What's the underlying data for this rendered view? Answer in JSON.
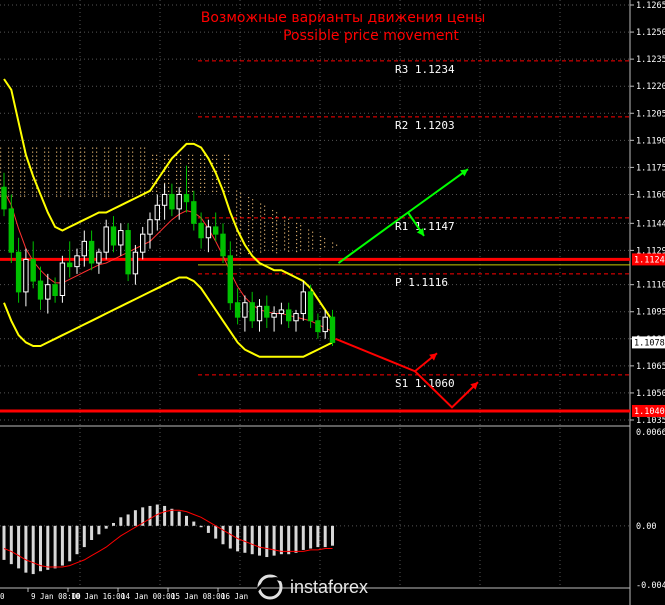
{
  "titles": {
    "ru": "Возможные варианты движения цены",
    "en": "Possible price movement"
  },
  "chart_data": {
    "type": "candlestick",
    "main_axis": {
      "ticks": [
        "1.1265",
        "1.1250",
        "1.1235",
        "1.1220",
        "1.1205",
        "1.1190",
        "1.1175",
        "1.1160",
        "1.1144",
        "1.1129",
        "1.1110",
        "1.1095",
        "1.1080",
        "1.1065",
        "1.1050",
        "1.1035"
      ],
      "ylim": [
        1.1035,
        1.1265
      ],
      "current_price": "1.1078",
      "marked_price_upper": "1.1124",
      "marked_price_lower": "1.1040"
    },
    "sub_axis": {
      "ticks": [
        "0.00661",
        "0.00",
        "-0.00417"
      ],
      "ylim": [
        -0.00417,
        0.00661
      ]
    },
    "levels": [
      {
        "label": "R3",
        "value": "1.1234",
        "price": 1.1234
      },
      {
        "label": "R2",
        "value": "1.1203",
        "price": 1.1203
      },
      {
        "label": "R1",
        "value": "1.1147",
        "price": 1.1147
      },
      {
        "label": "P",
        "value": "1.1116",
        "price": 1.1116
      },
      {
        "label": "S1",
        "value": "1.1060",
        "price": 1.106
      }
    ],
    "x_ticks": [
      "9 Jan 08:00",
      "10 Jan 16:00",
      "14 Jan 00:00",
      "15 Jan 08:00",
      "16 Jan"
    ],
    "x_tick_partial": "0",
    "colors": {
      "bull": "#ffffff",
      "bear": "#00c000",
      "level": "#ff0000",
      "bollinger": "#ffff00",
      "kumo": "#d4a96a",
      "arrow_up": "#00ff00",
      "arrow_down": "#ff0000",
      "macd_signal": "#ff0000",
      "grid": "#555555"
    },
    "candles": [
      [
        1.1164,
        1.1172,
        1.1148,
        1.1152
      ],
      [
        1.1152,
        1.116,
        1.1122,
        1.1128
      ],
      [
        1.1128,
        1.1136,
        1.11,
        1.1106
      ],
      [
        1.1106,
        1.113,
        1.1098,
        1.1124
      ],
      [
        1.1124,
        1.1134,
        1.1108,
        1.1112
      ],
      [
        1.1112,
        1.112,
        1.1096,
        1.1102
      ],
      [
        1.1102,
        1.1116,
        1.1094,
        1.111
      ],
      [
        1.111,
        1.1114,
        1.11,
        1.1104
      ],
      [
        1.1104,
        1.1126,
        1.11,
        1.1122
      ],
      [
        1.1122,
        1.1134,
        1.1114,
        1.112
      ],
      [
        1.112,
        1.113,
        1.1116,
        1.1126
      ],
      [
        1.1126,
        1.114,
        1.112,
        1.1134
      ],
      [
        1.1134,
        1.114,
        1.1118,
        1.1122
      ],
      [
        1.1122,
        1.113,
        1.1116,
        1.1128
      ],
      [
        1.1128,
        1.1146,
        1.1124,
        1.1142
      ],
      [
        1.1142,
        1.1148,
        1.1128,
        1.1132
      ],
      [
        1.1132,
        1.1144,
        1.1126,
        1.114
      ],
      [
        1.114,
        1.1144,
        1.1112,
        1.1116
      ],
      [
        1.1116,
        1.1132,
        1.111,
        1.1128
      ],
      [
        1.1128,
        1.1142,
        1.1124,
        1.1138
      ],
      [
        1.1138,
        1.115,
        1.113,
        1.1146
      ],
      [
        1.1146,
        1.116,
        1.114,
        1.1154
      ],
      [
        1.1154,
        1.1166,
        1.1146,
        1.116
      ],
      [
        1.116,
        1.1166,
        1.1148,
        1.1152
      ],
      [
        1.1152,
        1.1164,
        1.1146,
        1.116
      ],
      [
        1.116,
        1.1176,
        1.115,
        1.1156
      ],
      [
        1.1156,
        1.1162,
        1.114,
        1.1144
      ],
      [
        1.1144,
        1.115,
        1.113,
        1.1136
      ],
      [
        1.1136,
        1.1146,
        1.1128,
        1.1142
      ],
      [
        1.1142,
        1.115,
        1.1134,
        1.1138
      ],
      [
        1.1138,
        1.1144,
        1.1122,
        1.1126
      ],
      [
        1.1126,
        1.1134,
        1.1096,
        1.11
      ],
      [
        1.11,
        1.1108,
        1.1088,
        1.1092
      ],
      [
        1.1092,
        1.1104,
        1.1084,
        1.11
      ],
      [
        1.11,
        1.1106,
        1.1086,
        1.109
      ],
      [
        1.109,
        1.1102,
        1.1084,
        1.1098
      ],
      [
        1.1098,
        1.1104,
        1.1086,
        1.1092
      ],
      [
        1.1092,
        1.1098,
        1.1084,
        1.1094
      ],
      [
        1.1094,
        1.11,
        1.1088,
        1.1096
      ],
      [
        1.1096,
        1.11,
        1.1086,
        1.109
      ],
      [
        1.109,
        1.1096,
        1.1084,
        1.1094
      ],
      [
        1.1094,
        1.1112,
        1.109,
        1.1106
      ],
      [
        1.1106,
        1.111,
        1.1086,
        1.109
      ],
      [
        1.109,
        1.1094,
        1.108,
        1.1084
      ],
      [
        1.1084,
        1.1096,
        1.108,
        1.1092
      ],
      [
        1.1092,
        1.1096,
        1.1076,
        1.1078
      ]
    ],
    "bollinger_upper": [
      1.1224,
      1.1218,
      1.12,
      1.1182,
      1.117,
      1.116,
      1.115,
      1.1142,
      1.114,
      1.1142,
      1.1144,
      1.1146,
      1.1148,
      1.115,
      1.115,
      1.1152,
      1.1154,
      1.1156,
      1.1158,
      1.116,
      1.1162,
      1.1168,
      1.1174,
      1.118,
      1.1184,
      1.1188,
      1.1188,
      1.1186,
      1.118,
      1.1172,
      1.1162,
      1.115,
      1.114,
      1.1132,
      1.1126,
      1.1122,
      1.112,
      1.1118,
      1.1118,
      1.1116,
      1.1114,
      1.1112,
      1.1108,
      1.1102,
      1.1096,
      1.109
    ],
    "bollinger_lower": [
      1.11,
      1.109,
      1.1082,
      1.1078,
      1.1076,
      1.1076,
      1.1078,
      1.108,
      1.1082,
      1.1084,
      1.1086,
      1.1088,
      1.109,
      1.1092,
      1.1094,
      1.1096,
      1.1098,
      1.11,
      1.1102,
      1.1104,
      1.1106,
      1.1108,
      1.111,
      1.1112,
      1.1114,
      1.1114,
      1.1112,
      1.1108,
      1.1102,
      1.1096,
      1.109,
      1.1084,
      1.1078,
      1.1074,
      1.1072,
      1.107,
      1.107,
      1.107,
      1.107,
      1.107,
      1.107,
      1.107,
      1.1072,
      1.1074,
      1.1076,
      1.1078
    ],
    "macd_histogram": [
      -0.0024,
      -0.0027,
      -0.003,
      -0.0033,
      -0.0034,
      -0.0032,
      -0.0031,
      -0.003,
      -0.0028,
      -0.0025,
      -0.002,
      -0.0015,
      -0.001,
      -0.0006,
      -0.0002,
      0.0002,
      0.0006,
      0.0008,
      0.0011,
      0.0013,
      0.0014,
      0.0015,
      0.0014,
      0.0012,
      0.001,
      0.0007,
      0.0003,
      -0.0001,
      -0.0005,
      -0.0009,
      -0.0013,
      -0.0016,
      -0.0018,
      -0.0019,
      -0.002,
      -0.0021,
      -0.0022,
      -0.0021,
      -0.002,
      -0.002,
      -0.0019,
      -0.0017,
      -0.0016,
      -0.0015,
      -0.0015,
      -0.0014
    ],
    "macd_signal": [
      -0.0016,
      -0.0018,
      -0.0021,
      -0.0024,
      -0.0026,
      -0.0028,
      -0.0029,
      -0.0029,
      -0.0029,
      -0.0028,
      -0.0026,
      -0.0024,
      -0.0021,
      -0.0018,
      -0.0015,
      -0.0011,
      -0.0007,
      -0.0004,
      -0.0001,
      0.0002,
      0.0005,
      0.0008,
      0.001,
      0.0011,
      0.0011,
      0.001,
      0.0008,
      0.0006,
      0.0003,
      -0.0,
      -0.0003,
      -0.0006,
      -0.0009,
      -0.0011,
      -0.0013,
      -0.0015,
      -0.0016,
      -0.0017,
      -0.0018,
      -0.0018,
      -0.0018,
      -0.0018,
      -0.0017,
      -0.0017,
      -0.0016,
      -0.0016
    ]
  },
  "watermark": "instaforex"
}
